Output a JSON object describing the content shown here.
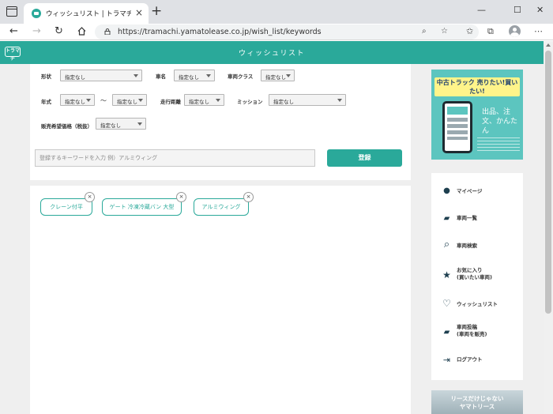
{
  "browser": {
    "tab_title": "ウィッシュリスト | トラマチ。- かんたん",
    "tab_close": "×",
    "new_tab": "+",
    "url": "https://tramachi.yamatolease.co.jp/wish_list/keywords",
    "window_controls": {
      "minimize": "—",
      "maximize": "☐",
      "close": "✕"
    },
    "nav": {
      "back": "←",
      "forward": "→",
      "reload": "↻"
    },
    "toolbar_icons": {
      "zoom": "⌕",
      "favorite_add": "☆",
      "favorites": "✩",
      "collections": "⧉",
      "menu": "⋯"
    }
  },
  "site": {
    "logo": "トラマチ",
    "title": "ウィッシュリスト"
  },
  "filters": {
    "shape_label": "形状",
    "shape_value": "指定なし",
    "vehicle_name_label": "車名",
    "vehicle_name_value": "指定なし",
    "vehicle_class_label": "車両クラス",
    "vehicle_class_value": "指定なし",
    "year_label": "年式",
    "year_from": "指定なし",
    "year_separator": "〜",
    "year_to": "指定なし",
    "mileage_label": "走行距離",
    "mileage_value": "指定なし",
    "transmission_label": "ミッション",
    "transmission_value": "指定なし",
    "price_label": "販売希望価格（税抜）",
    "price_value": "指定なし"
  },
  "keyword_input": {
    "placeholder": "登録するキーワードを入力 例）アルミウィング",
    "value": ""
  },
  "register_button": "登録",
  "tags": [
    {
      "label": "クレーン付平",
      "remove": "×"
    },
    {
      "label": "ゲート 冷凍冷蔵バン 大型",
      "remove": "×"
    },
    {
      "label": "アルミウィング",
      "remove": "×"
    }
  ],
  "banner": {
    "headline": "中古トラック 売りたい!買いたい!",
    "sub": "出品、注文、かんたん"
  },
  "side_menu": [
    {
      "icon": "user-icon",
      "glyph": "●",
      "label": "マイページ"
    },
    {
      "icon": "truck-icon",
      "glyph": "▰",
      "label": "車両一覧"
    },
    {
      "icon": "search-icon",
      "glyph": "⌕",
      "label": "車両検索"
    },
    {
      "icon": "star-icon",
      "glyph": "★",
      "label": "お気に入り\n(買いたい車両)"
    },
    {
      "icon": "heart-icon",
      "glyph": "♡",
      "label": "ウィッシュリスト"
    },
    {
      "icon": "truck-post-icon",
      "glyph": "▰",
      "label": "車両投稿\n(車両を販売)"
    },
    {
      "icon": "logout-icon",
      "glyph": "⇥",
      "label": "ログアウト"
    }
  ],
  "lease_banner": {
    "line1": "リースだけじゃない",
    "line2": "ヤマトリース"
  },
  "colors": {
    "brand": "#2aa99a",
    "banner_bg": "#5cc5bf",
    "page_bg": "#efefef"
  }
}
